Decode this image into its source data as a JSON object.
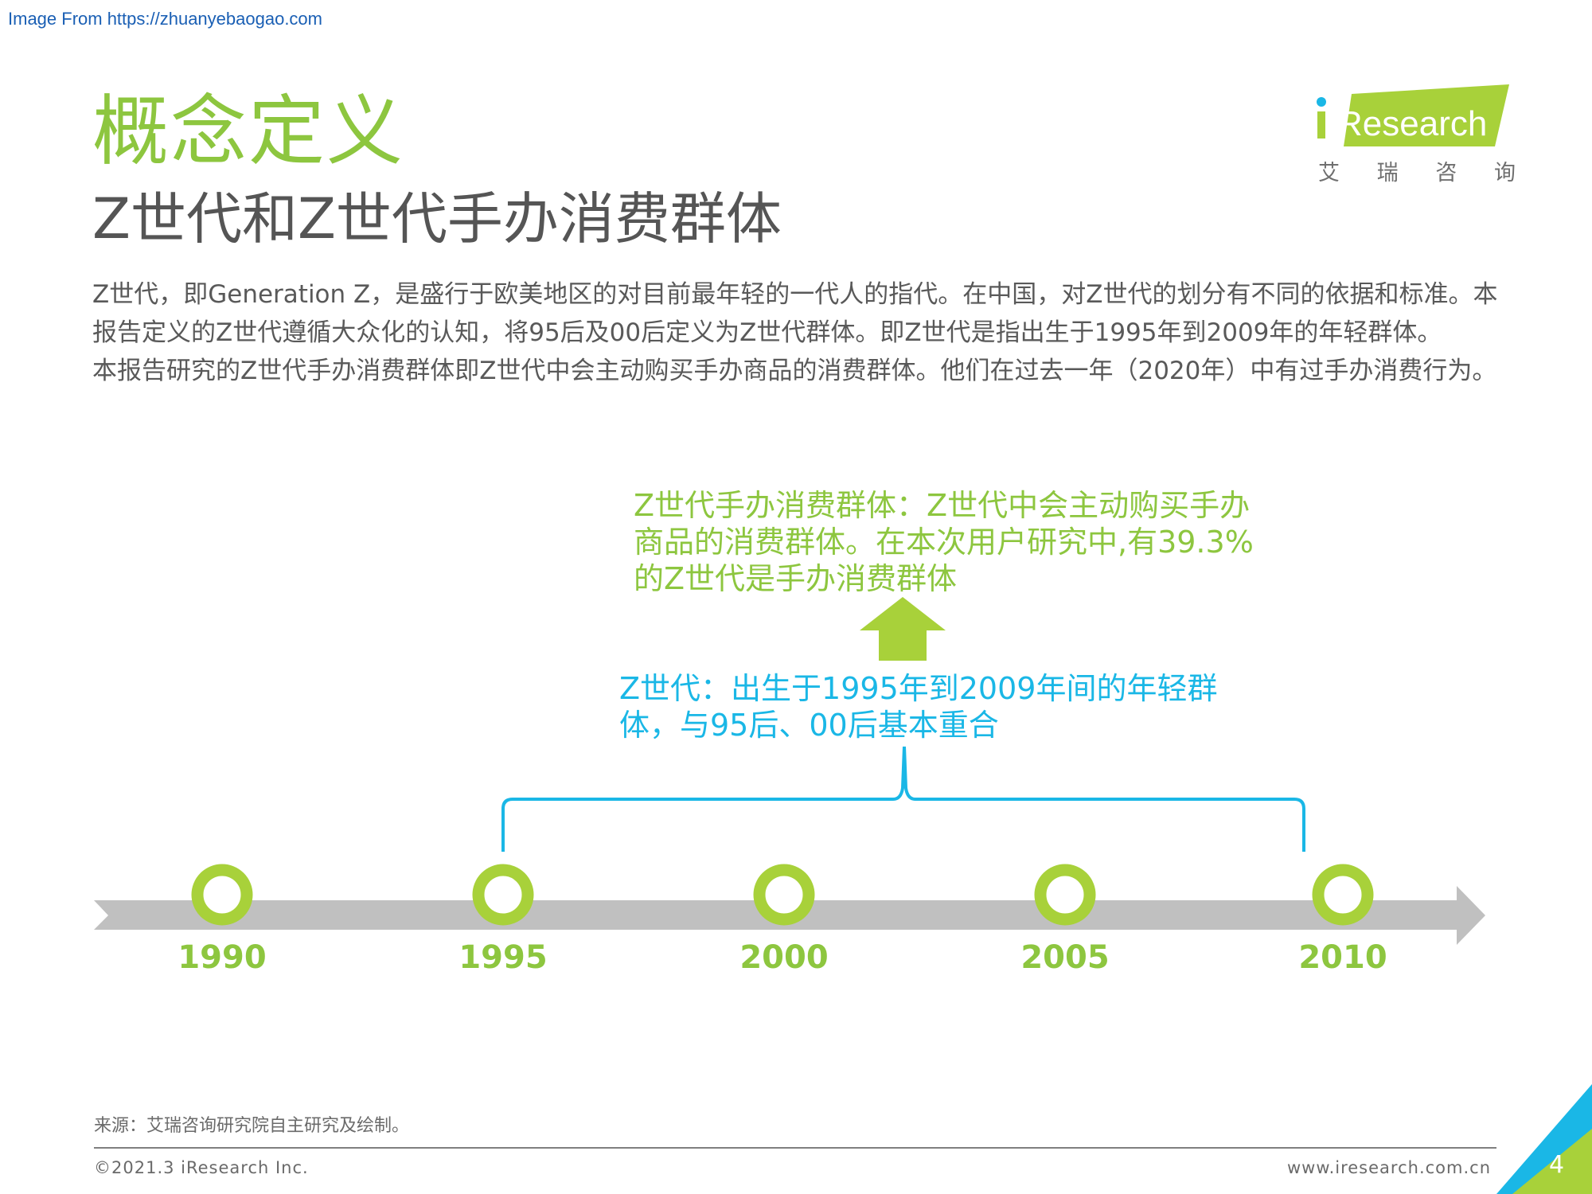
{
  "watermark": "Image From https://zhuanyebaogao.com",
  "header": {
    "title": "概念定义",
    "subtitle": "Z世代和Z世代手办消费群体"
  },
  "logo": {
    "brand": "Research",
    "sub_chars": [
      "艾",
      "瑞",
      "咨",
      "询"
    ],
    "colors": {
      "green": "#a8d13a",
      "blue": "#1ab7e6"
    }
  },
  "body": {
    "paragraphs": [
      "Z世代，即Generation Z，是盛行于欧美地区的对目前最年轻的一代人的指代。在中国，对Z世代的划分有不同的依据和标准。本报告定义的Z世代遵循大众化的认知，将95后及00后定义为Z世代群体。即Z世代是指出生于1995年到2009年的年轻群体。",
      "本报告研究的Z世代手办消费群体即Z世代中会主动购买手办商品的消费群体。他们在过去一年（2020年）中有过手办消费行为。"
    ]
  },
  "diagram": {
    "callout_green": "Z世代手办消费群体：Z世代中会主动购买手办商品的消费群体。在本次用户研究中,有39.3%的Z世代是手办消费群体",
    "callout_blue": "Z世代：出生于1995年到2009年间的年轻群体，与95后、00后基本重合",
    "years": [
      "1990",
      "1995",
      "2000",
      "2005",
      "2010"
    ],
    "colors": {
      "green": "#a8d13a",
      "blue": "#1ab7e6",
      "axis": "#c0c0c0"
    }
  },
  "footer": {
    "source": "来源：艾瑞咨询研究院自主研究及绘制。",
    "copyright": "©2021.3 iResearch Inc.",
    "website": "www.iresearch.com.cn",
    "page_number": "4"
  }
}
